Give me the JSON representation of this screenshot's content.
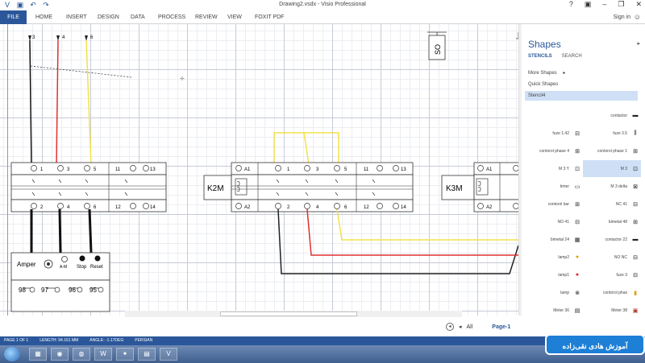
{
  "window": {
    "title": "Drawing2.vsdx - Visio Professional",
    "controls": [
      "?",
      "▣",
      "–",
      "❐",
      "✕"
    ]
  },
  "ribbon": {
    "file": "FILE",
    "tabs": [
      "HOME",
      "INSERT",
      "DESIGN",
      "DATA",
      "PROCESS",
      "REVIEW",
      "VIEW",
      "FOXIT PDF"
    ],
    "sign_in": "Sign in"
  },
  "diagram": {
    "feed_labels": [
      "3",
      "4",
      "6"
    ],
    "k1": {
      "top_terminals": [
        "1",
        "3",
        "5",
        "11",
        "13"
      ],
      "bottom_terminals": [
        "2",
        "4",
        "6",
        "12",
        "14"
      ]
    },
    "amper_panel": {
      "label": "Amper",
      "am_label": "A-M",
      "stop_label": "Stop",
      "reset_label": "Reset",
      "contacts": [
        "98",
        "97",
        "96",
        "95"
      ]
    },
    "k2m": {
      "label": "K2M",
      "coil_top": "A1",
      "coil_bottom": "A2",
      "top_terminals": [
        "1",
        "3",
        "5",
        "11",
        "13"
      ],
      "bottom_terminals": [
        "2",
        "4",
        "6",
        "12",
        "14"
      ]
    },
    "k3m": {
      "label": "K3M",
      "coil_top": "A1",
      "coil_bottom": "A2"
    },
    "so_label": "SO"
  },
  "shapes_pane": {
    "title": "Shapes",
    "tabs": [
      "STENCILS",
      "SEARCH"
    ],
    "more_shapes": "More Shapes",
    "quick_shapes": "Quick Shapes",
    "stencil": "Stencil4",
    "items": [
      {
        "label": "contactor",
        "icon": "▬"
      },
      {
        "label": "fuze 1.42",
        "icon": "⊟"
      },
      {
        "label": "fuze 3.5",
        "icon": "⫼"
      },
      {
        "label": "contorol phase 4",
        "icon": "⊞"
      },
      {
        "label": "contorol phase 1",
        "icon": "⊞"
      },
      {
        "label": "M 3 Y",
        "icon": "⊡"
      },
      {
        "label": "M 3",
        "icon": "⊡"
      },
      {
        "label": "timer",
        "icon": "▭"
      },
      {
        "label": "M 3 delta",
        "icon": "⊠"
      },
      {
        "label": "contorol bar",
        "icon": "⊞"
      },
      {
        "label": "NC 41",
        "icon": "⊟"
      },
      {
        "label": "NO 41",
        "icon": "⊟"
      },
      {
        "label": "bimetal 48",
        "icon": "⊞"
      },
      {
        "label": "bimetal 24",
        "icon": "▦"
      },
      {
        "label": "contactor 22",
        "icon": "▬"
      },
      {
        "label": "lamp2",
        "icon": "●"
      },
      {
        "label": "NO NC",
        "icon": "⊟"
      },
      {
        "label": "lamp1",
        "icon": "●"
      },
      {
        "label": "fuze 3",
        "icon": "⊟"
      },
      {
        "label": "lamp",
        "icon": "⊗"
      },
      {
        "label": "contorol phas",
        "icon": "▮"
      },
      {
        "label": "Meter 36",
        "icon": "▤"
      },
      {
        "label": "Meter 38",
        "icon": "▣"
      }
    ]
  },
  "page_nav": {
    "all": "All",
    "page": "Page-1"
  },
  "status": {
    "page": "PAGE 1 OF 1",
    "length": "LENGTH: 94.161 MM",
    "angle": "ANGLE: -1.17DEG",
    "language": "PERSIAN"
  },
  "watermark": "آموزش هادی نقی‌زاده",
  "colors": {
    "accent": "#2b579a",
    "red_wire": "#e03030",
    "yellow_wire": "#f2e24a"
  }
}
